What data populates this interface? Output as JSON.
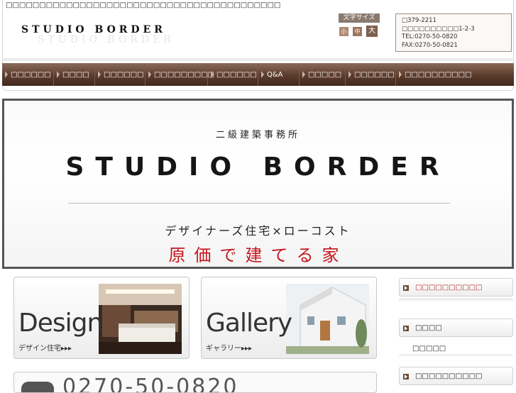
{
  "header": {
    "tagline": "□□□□□□□□□□□□□□□□□□□□□□□□□□□□□□□□□□□□□□□□□",
    "logo": "STUDIO BORDER",
    "font_size": {
      "label": "文字サイズ",
      "small": "小",
      "medium": "中",
      "large": "大"
    },
    "contact": {
      "postal": "□379-2211",
      "address": "□□□□□□□□□□1-2-3",
      "tel": "TEL:0270-50-0820",
      "fax": "FAX:0270-50-0821"
    }
  },
  "nav": {
    "items": [
      {
        "label": "□□□□□□"
      },
      {
        "label": "□□□□"
      },
      {
        "label": "□□□□□□"
      },
      {
        "label": "□□□□□□□□□"
      },
      {
        "label": "□□□□□□"
      },
      {
        "label": "Q&A"
      },
      {
        "label": "□□□□□"
      },
      {
        "label": "□□□□□□"
      },
      {
        "label": "□□□□□□□□□□"
      }
    ]
  },
  "banner": {
    "subtitle": "二級建築事務所",
    "title": "STUDIO BORDER",
    "slogan": "デザイナーズ住宅×ローコスト",
    "tagline_red": "原価で建てる家"
  },
  "cards": [
    {
      "big": "Design",
      "small": "デザイン住宅▸▸▸"
    },
    {
      "big": "Gallery",
      "small": "ギャラリー▸▸▸"
    }
  ],
  "phone_partial": "0270-50-0820",
  "sidebar": {
    "box1": "□□□□□□□□□□",
    "box2": "□□□□",
    "box2_sub": "□□□□□",
    "box3": "□□□□□□□□□□"
  },
  "colors": {
    "nav_top": "#8b6a58",
    "nav_bottom": "#43291d",
    "accent_red": "#c4161c",
    "sidebar_red": "#b52a1c"
  }
}
